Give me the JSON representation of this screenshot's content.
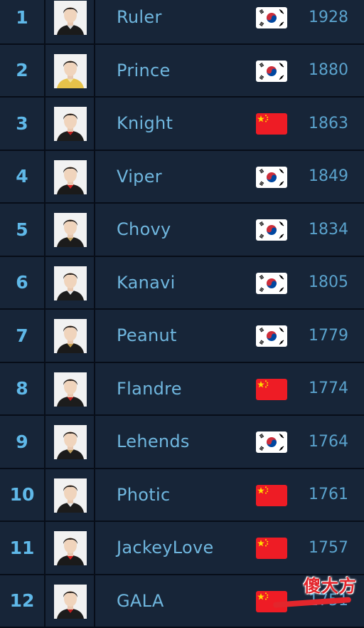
{
  "leaderboard": {
    "rows": [
      {
        "rank": "1",
        "name": "Ruler",
        "country": "kr",
        "flag_icon": "south-korea-flag-icon",
        "score": "1928",
        "jersey": "#1a1a1a",
        "accent": "#d8d8d8"
      },
      {
        "rank": "2",
        "name": "Prince",
        "country": "kr",
        "flag_icon": "south-korea-flag-icon",
        "score": "1880",
        "jersey": "#e6c24a",
        "accent": "#f1e2a0"
      },
      {
        "rank": "3",
        "name": "Knight",
        "country": "cn",
        "flag_icon": "china-flag-icon",
        "score": "1863",
        "jersey": "#1c1c1c",
        "accent": "#c02020"
      },
      {
        "rank": "4",
        "name": "Viper",
        "country": "kr",
        "flag_icon": "south-korea-flag-icon",
        "score": "1849",
        "jersey": "#1a1a1a",
        "accent": "#d42020"
      },
      {
        "rank": "5",
        "name": "Chovy",
        "country": "kr",
        "flag_icon": "south-korea-flag-icon",
        "score": "1834",
        "jersey": "#1b1b1b",
        "accent": "#bfa060"
      },
      {
        "rank": "6",
        "name": "Kanavi",
        "country": "kr",
        "flag_icon": "south-korea-flag-icon",
        "score": "1805",
        "jersey": "#1c1c1c",
        "accent": "#e8e8e8"
      },
      {
        "rank": "7",
        "name": "Peanut",
        "country": "kr",
        "flag_icon": "south-korea-flag-icon",
        "score": "1779",
        "jersey": "#1a1a1a",
        "accent": "#c8a050"
      },
      {
        "rank": "8",
        "name": "Flandre",
        "country": "cn",
        "flag_icon": "china-flag-icon",
        "score": "1774",
        "jersey": "#1c1c1c",
        "accent": "#c02020"
      },
      {
        "rank": "9",
        "name": "Lehends",
        "country": "kr",
        "flag_icon": "south-korea-flag-icon",
        "score": "1764",
        "jersey": "#1b1b1b",
        "accent": "#bfa060"
      },
      {
        "rank": "10",
        "name": "Photic",
        "country": "cn",
        "flag_icon": "china-flag-icon",
        "score": "1761",
        "jersey": "#1c1c1c",
        "accent": "#e8e8e8"
      },
      {
        "rank": "11",
        "name": "JackeyLove",
        "country": "cn",
        "flag_icon": "china-flag-icon",
        "score": "1757",
        "jersey": "#1a1a1a",
        "accent": "#d42020"
      },
      {
        "rank": "12",
        "name": "GALA",
        "country": "cn",
        "flag_icon": "china-flag-icon",
        "score": "1751",
        "jersey": "#1c1c1c",
        "accent": "#c02020"
      }
    ]
  },
  "watermark": {
    "text": "傻大方"
  },
  "colors": {
    "background": "#172538",
    "divider": "#070d18",
    "rank_text": "#5fb8e8",
    "name_text": "#6fb6de",
    "score_text": "#5aa2cc"
  }
}
